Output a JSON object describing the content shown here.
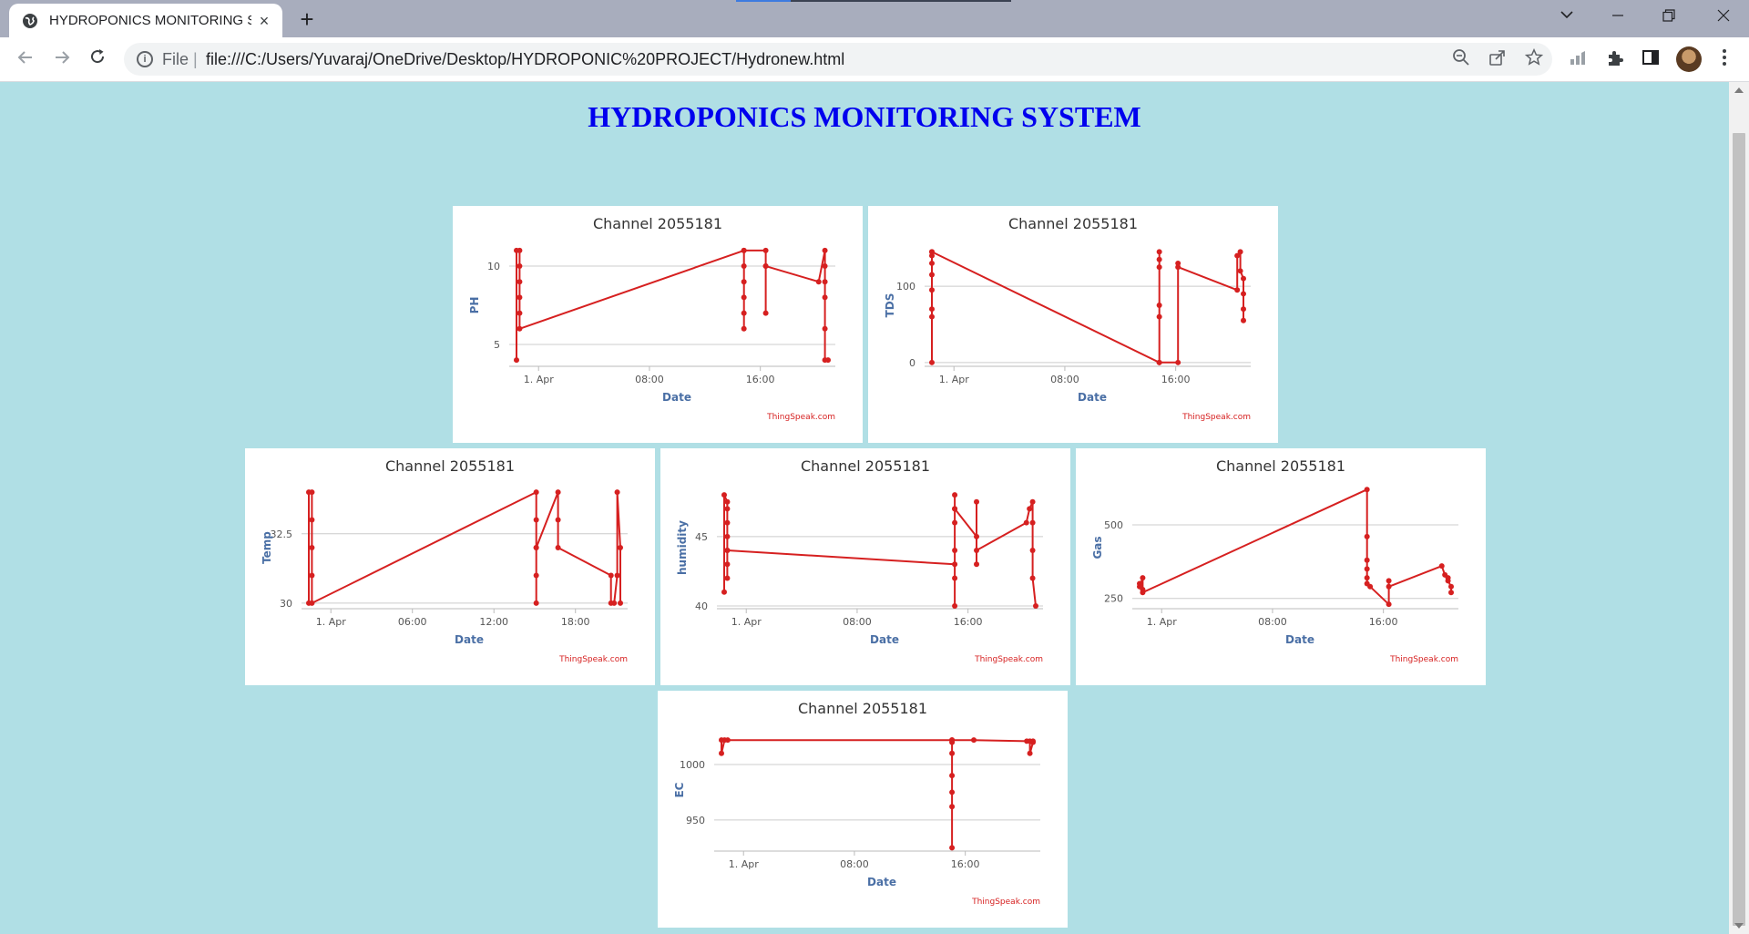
{
  "browser": {
    "tab_title": "HYDROPONICS MONITORING SYSTEM",
    "tab_close": "×",
    "new_tab": "+",
    "file_label": "File",
    "url": "file:///C:/Users/Yuvaraj/OneDrive/Desktop/HYDROPONIC%20PROJECT/Hydronew.html",
    "icons": [
      "globe-icon",
      "back-arrow-icon",
      "forward-arrow-icon",
      "reload-icon",
      "info-icon",
      "zoom-out-icon",
      "share-icon",
      "star-icon",
      "performance-icon",
      "extensions-puzzle-icon",
      "side-panel-icon",
      "avatar",
      "menu-kebab-icon",
      "chevron-down-icon",
      "minimize-icon",
      "restore-icon",
      "close-icon"
    ]
  },
  "page": {
    "title": "HYDROPONICS MONITORING SYSTEM"
  },
  "colors": {
    "page_background": "#b0dfe5",
    "title": "#0000ee",
    "series": "#d62020",
    "axis_label": "#4a6fa5",
    "watermark": "#d62020"
  },
  "chart_data": [
    {
      "type": "line",
      "title": "Channel 2055181",
      "xlabel": "Date",
      "ylabel": "PH",
      "x_ticks": [
        "1. Apr",
        "08:00",
        "16:00"
      ],
      "y_ticks": [
        5,
        10
      ],
      "ylim": [
        3.6,
        11.4
      ],
      "grid": true,
      "credit": "ThingSpeak.com",
      "series": [
        {
          "values": [
            {
              "x": 0.0,
              "y": 4
            },
            {
              "x": 0.0,
              "y": 11
            },
            {
              "x": 0.01,
              "y": 11
            },
            {
              "x": 0.01,
              "y": 10
            },
            {
              "x": 0.01,
              "y": 9
            },
            {
              "x": 0.01,
              "y": 8
            },
            {
              "x": 0.01,
              "y": 7
            },
            {
              "x": 0.01,
              "y": 6
            },
            {
              "x": 0.73,
              "y": 11
            },
            {
              "x": 0.73,
              "y": 10
            },
            {
              "x": 0.73,
              "y": 9
            },
            {
              "x": 0.73,
              "y": 8
            },
            {
              "x": 0.73,
              "y": 7
            },
            {
              "x": 0.73,
              "y": 6
            },
            {
              "x": 0.73,
              "y": 11
            },
            {
              "x": 0.8,
              "y": 11
            },
            {
              "x": 0.8,
              "y": 10
            },
            {
              "x": 0.8,
              "y": 7
            },
            {
              "x": 0.8,
              "y": 10
            },
            {
              "x": 0.97,
              "y": 9
            },
            {
              "x": 0.99,
              "y": 11
            },
            {
              "x": 0.99,
              "y": 10
            },
            {
              "x": 0.99,
              "y": 9
            },
            {
              "x": 0.99,
              "y": 8
            },
            {
              "x": 0.99,
              "y": 6
            },
            {
              "x": 0.99,
              "y": 4
            },
            {
              "x": 1.0,
              "y": 4
            }
          ]
        }
      ]
    },
    {
      "type": "line",
      "title": "Channel 2055181",
      "xlabel": "Date",
      "ylabel": "TDS",
      "x_ticks": [
        "1. Apr",
        "08:00",
        "16:00"
      ],
      "y_ticks": [
        0,
        100
      ],
      "ylim": [
        -5,
        155
      ],
      "grid": true,
      "credit": "ThingSpeak.com",
      "series": [
        {
          "values": [
            {
              "x": 0.0,
              "y": 0
            },
            {
              "x": 0.0,
              "y": 145
            },
            {
              "x": 0.0,
              "y": 140
            },
            {
              "x": 0.0,
              "y": 130
            },
            {
              "x": 0.0,
              "y": 115
            },
            {
              "x": 0.0,
              "y": 95
            },
            {
              "x": 0.0,
              "y": 70
            },
            {
              "x": 0.0,
              "y": 60
            },
            {
              "x": 0.0,
              "y": 145
            },
            {
              "x": 0.73,
              "y": 0
            },
            {
              "x": 0.73,
              "y": 145
            },
            {
              "x": 0.73,
              "y": 135
            },
            {
              "x": 0.73,
              "y": 125
            },
            {
              "x": 0.73,
              "y": 75
            },
            {
              "x": 0.73,
              "y": 60
            },
            {
              "x": 0.73,
              "y": 0
            },
            {
              "x": 0.79,
              "y": 0
            },
            {
              "x": 0.79,
              "y": 130
            },
            {
              "x": 0.79,
              "y": 125
            },
            {
              "x": 0.98,
              "y": 95
            },
            {
              "x": 0.98,
              "y": 140
            },
            {
              "x": 0.99,
              "y": 145
            },
            {
              "x": 0.99,
              "y": 120
            },
            {
              "x": 1.0,
              "y": 110
            },
            {
              "x": 1.0,
              "y": 90
            },
            {
              "x": 1.0,
              "y": 70
            },
            {
              "x": 1.0,
              "y": 55
            }
          ]
        }
      ]
    },
    {
      "type": "line",
      "title": "Channel 2055181",
      "xlabel": "Date",
      "ylabel": "Temp",
      "x_ticks": [
        "1. Apr",
        "06:00",
        "12:00",
        "18:00"
      ],
      "y_ticks": [
        30,
        32.5
      ],
      "ylim": [
        29.8,
        34.2
      ],
      "grid": true,
      "credit": "ThingSpeak.com",
      "series": [
        {
          "values": [
            {
              "x": 0.0,
              "y": 30
            },
            {
              "x": 0.0,
              "y": 34
            },
            {
              "x": 0.01,
              "y": 34
            },
            {
              "x": 0.01,
              "y": 33
            },
            {
              "x": 0.01,
              "y": 32
            },
            {
              "x": 0.01,
              "y": 31
            },
            {
              "x": 0.01,
              "y": 30
            },
            {
              "x": 0.73,
              "y": 34
            },
            {
              "x": 0.73,
              "y": 33
            },
            {
              "x": 0.73,
              "y": 32
            },
            {
              "x": 0.73,
              "y": 31
            },
            {
              "x": 0.73,
              "y": 30
            },
            {
              "x": 0.73,
              "y": 32
            },
            {
              "x": 0.8,
              "y": 34
            },
            {
              "x": 0.8,
              "y": 33
            },
            {
              "x": 0.8,
              "y": 32
            },
            {
              "x": 0.97,
              "y": 31
            },
            {
              "x": 0.97,
              "y": 30
            },
            {
              "x": 0.98,
              "y": 30
            },
            {
              "x": 0.99,
              "y": 31
            },
            {
              "x": 0.99,
              "y": 34
            },
            {
              "x": 1.0,
              "y": 32
            },
            {
              "x": 1.0,
              "y": 30
            }
          ]
        }
      ]
    },
    {
      "type": "line",
      "title": "Channel 2055181",
      "xlabel": "Date",
      "ylabel": "humidity",
      "x_ticks": [
        "1. Apr",
        "08:00",
        "16:00"
      ],
      "y_ticks": [
        40,
        45
      ],
      "ylim": [
        39.8,
        48.6
      ],
      "grid": true,
      "credit": "ThingSpeak.com",
      "series": [
        {
          "values": [
            {
              "x": 0.0,
              "y": 41
            },
            {
              "x": 0.0,
              "y": 48
            },
            {
              "x": 0.01,
              "y": 47.5
            },
            {
              "x": 0.01,
              "y": 47
            },
            {
              "x": 0.01,
              "y": 46
            },
            {
              "x": 0.01,
              "y": 45
            },
            {
              "x": 0.01,
              "y": 44
            },
            {
              "x": 0.01,
              "y": 43
            },
            {
              "x": 0.01,
              "y": 42
            },
            {
              "x": 0.01,
              "y": 44
            },
            {
              "x": 0.74,
              "y": 43
            },
            {
              "x": 0.74,
              "y": 40
            },
            {
              "x": 0.74,
              "y": 42
            },
            {
              "x": 0.74,
              "y": 44
            },
            {
              "x": 0.74,
              "y": 46
            },
            {
              "x": 0.74,
              "y": 47
            },
            {
              "x": 0.74,
              "y": 48
            },
            {
              "x": 0.74,
              "y": 47
            },
            {
              "x": 0.81,
              "y": 45
            },
            {
              "x": 0.81,
              "y": 43
            },
            {
              "x": 0.81,
              "y": 47.5
            },
            {
              "x": 0.81,
              "y": 44
            },
            {
              "x": 0.97,
              "y": 46
            },
            {
              "x": 0.98,
              "y": 47
            },
            {
              "x": 0.99,
              "y": 47.5
            },
            {
              "x": 0.99,
              "y": 46
            },
            {
              "x": 0.99,
              "y": 44
            },
            {
              "x": 0.99,
              "y": 42
            },
            {
              "x": 1.0,
              "y": 40
            }
          ]
        }
      ]
    },
    {
      "type": "line",
      "title": "Channel 2055181",
      "xlabel": "Date",
      "ylabel": "Gas",
      "x_ticks": [
        "1. Apr",
        "08:00",
        "16:00"
      ],
      "y_ticks": [
        250,
        500
      ],
      "ylim": [
        215,
        630
      ],
      "grid": true,
      "credit": "ThingSpeak.com",
      "series": [
        {
          "values": [
            {
              "x": 0.0,
              "y": 300
            },
            {
              "x": 0.0,
              "y": 290
            },
            {
              "x": 0.01,
              "y": 320
            },
            {
              "x": 0.01,
              "y": 280
            },
            {
              "x": 0.01,
              "y": 270
            },
            {
              "x": 0.73,
              "y": 620
            },
            {
              "x": 0.73,
              "y": 460
            },
            {
              "x": 0.73,
              "y": 380
            },
            {
              "x": 0.73,
              "y": 350
            },
            {
              "x": 0.73,
              "y": 320
            },
            {
              "x": 0.73,
              "y": 300
            },
            {
              "x": 0.74,
              "y": 290
            },
            {
              "x": 0.8,
              "y": 230
            },
            {
              "x": 0.8,
              "y": 310
            },
            {
              "x": 0.8,
              "y": 290
            },
            {
              "x": 0.97,
              "y": 360
            },
            {
              "x": 0.98,
              "y": 330
            },
            {
              "x": 0.99,
              "y": 320
            },
            {
              "x": 0.99,
              "y": 310
            },
            {
              "x": 1.0,
              "y": 290
            },
            {
              "x": 1.0,
              "y": 270
            }
          ]
        }
      ]
    },
    {
      "type": "line",
      "title": "Channel 2055181",
      "xlabel": "Date",
      "ylabel": "EC",
      "x_ticks": [
        "1. Apr",
        "08:00",
        "16:00"
      ],
      "y_ticks": [
        950,
        1000
      ],
      "ylim": [
        922,
        1032
      ],
      "grid": true,
      "credit": "ThingSpeak.com",
      "series": [
        {
          "values": [
            {
              "x": 0.0,
              "y": 1022
            },
            {
              "x": 0.0,
              "y": 1010
            },
            {
              "x": 0.01,
              "y": 1022
            },
            {
              "x": 0.02,
              "y": 1022
            },
            {
              "x": 0.74,
              "y": 1022
            },
            {
              "x": 0.74,
              "y": 1020
            },
            {
              "x": 0.74,
              "y": 1010
            },
            {
              "x": 0.74,
              "y": 990
            },
            {
              "x": 0.74,
              "y": 975
            },
            {
              "x": 0.74,
              "y": 962
            },
            {
              "x": 0.74,
              "y": 925
            },
            {
              "x": 0.74,
              "y": 1022
            },
            {
              "x": 0.81,
              "y": 1022
            },
            {
              "x": 0.98,
              "y": 1021
            },
            {
              "x": 0.99,
              "y": 1021
            },
            {
              "x": 0.99,
              "y": 1010
            },
            {
              "x": 1.0,
              "y": 1020
            },
            {
              "x": 1.0,
              "y": 1021
            }
          ]
        }
      ]
    }
  ]
}
